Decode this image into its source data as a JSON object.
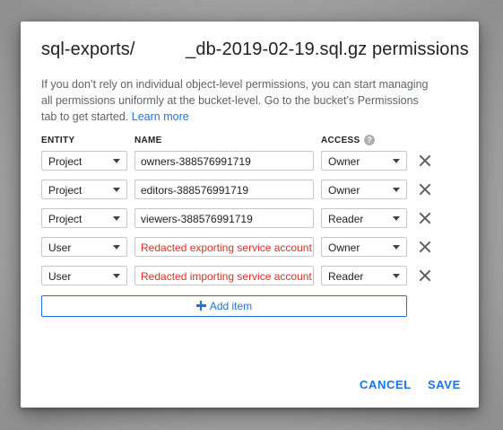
{
  "dialog": {
    "title": "sql-exports/          _db-2019-02-19.sql.gz permissions",
    "description": "If you don’t rely on individual object-level permissions, you can start managing all permissions uniformly at the bucket-level. Go to the bucket’s Permissions tab to get started.",
    "learn_more": "Learn more",
    "columns": {
      "entity": "ENTITY",
      "name": "NAME",
      "access": "ACCESS"
    },
    "help_icon": "help-circle-icon",
    "remove_icon": "close-icon",
    "rows": [
      {
        "entity": "Project",
        "name": "owners-388576991719",
        "access": "Owner",
        "redacted": false
      },
      {
        "entity": "Project",
        "name": "editors-388576991719",
        "access": "Owner",
        "redacted": false
      },
      {
        "entity": "Project",
        "name": "viewers-388576991719",
        "access": "Reader",
        "redacted": false
      },
      {
        "entity": "User",
        "name": "Redacted exporting service account",
        "access": "Owner",
        "redacted": true
      },
      {
        "entity": "User",
        "name": "Redacted importing service account",
        "access": "Reader",
        "redacted": true
      }
    ],
    "add_item_label": "Add item",
    "cancel_label": "CANCEL",
    "save_label": "SAVE",
    "colors": {
      "accent": "#1a73e8",
      "redacted_text": "#d93025"
    }
  }
}
